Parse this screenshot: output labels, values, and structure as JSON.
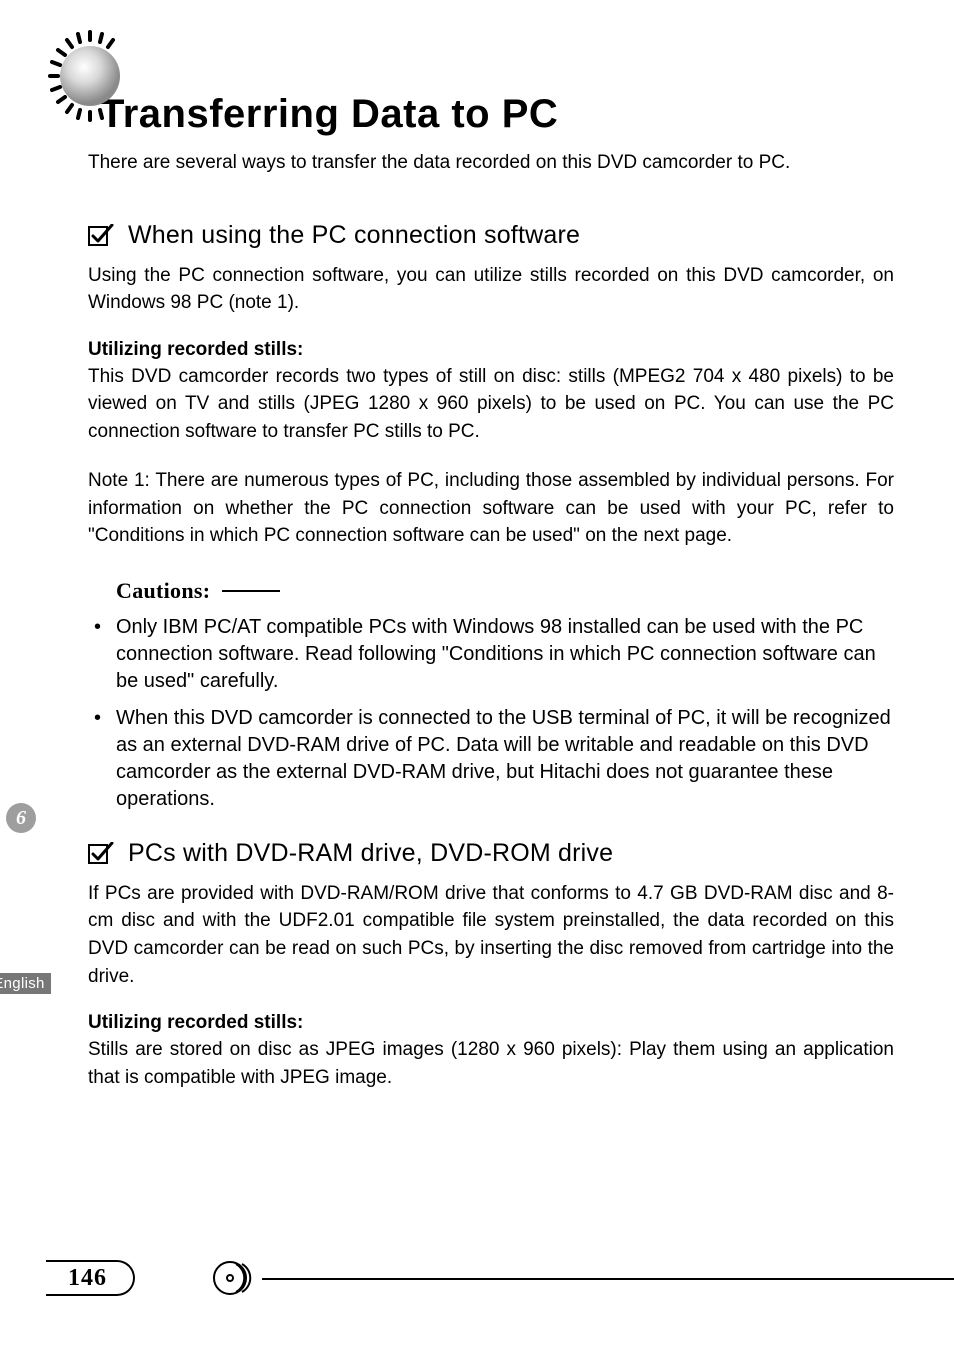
{
  "header": {
    "title": "Transferring Data to PC",
    "intro": "There are several ways to transfer the data recorded on this DVD camcorder to PC."
  },
  "section1": {
    "title": "When using the PC connection software",
    "p1": "Using the PC connection software, you can utilize stills recorded on this DVD camcorder, on Windows 98 PC (note 1).",
    "stills_head": "Utilizing recorded stills:",
    "stills_body": "This DVD camcorder records two types of still on disc: stills (MPEG2 704 x 480 pixels) to be viewed on TV and stills (JPEG 1280 x 960 pixels) to be used on PC. You can use the PC connection software to transfer PC stills to PC.",
    "note1": "Note 1: There are numerous types of PC, including those assembled by individual persons. For information on whether the PC connection software can be used with your PC, refer to \"Conditions in which PC connection software can be used\" on the next page."
  },
  "cautions": {
    "label": "Cautions:",
    "items": [
      "Only IBM PC/AT compatible PCs with Windows 98 installed can be used with the PC connection software. Read following \"Conditions in which PC connection software can be used\" carefully.",
      "When this DVD camcorder is connected to the USB terminal of PC, it will be recognized as an external DVD-RAM drive of PC. Data will be writable and readable on this DVD camcorder as the external DVD-RAM drive, but Hitachi does not guarantee these operations."
    ]
  },
  "section2": {
    "title": "PCs with DVD-RAM drive, DVD-ROM drive",
    "p1": "If PCs are provided with DVD-RAM/ROM drive that conforms to 4.7 GB DVD-RAM disc and 8-cm disc and with the UDF2.01 compatible file system preinstalled, the data recorded on this DVD camcorder can be read on such PCs, by inserting the disc removed from cartridge into the drive.",
    "stills_head": "Utilizing recorded stills:",
    "stills_body": "Stills are stored on disc as JPEG images (1280 x 960 pixels): Play them using an application that is compatible with JPEG image."
  },
  "side": {
    "chapter_number": "6",
    "language": "English"
  },
  "footer": {
    "page_number": "146"
  }
}
